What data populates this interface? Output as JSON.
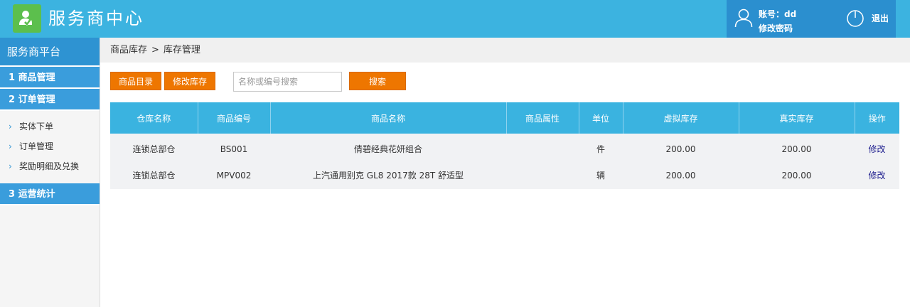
{
  "header": {
    "app_title": "服务商中心",
    "account_label": "账号：dd",
    "change_password": "修改密码",
    "logout": "退出",
    "colors": {
      "bar": "#3cb3e0",
      "user_panel": "#2b8fcf",
      "logo_bg": "#5cbf4d"
    }
  },
  "sidebar": {
    "title": "服务商平台",
    "groups": [
      {
        "label": "1 商品管理"
      },
      {
        "label": "2 订单管理",
        "items": [
          "实体下单",
          "订单管理",
          "奖励明细及兑换"
        ]
      },
      {
        "label": "3 运营统计"
      }
    ]
  },
  "breadcrumb": {
    "parent": "商品库存",
    "separator": ">",
    "current": "库存管理"
  },
  "toolbar": {
    "catalog_button": "商品目录",
    "edit_stock_button": "修改库存",
    "search_placeholder": "名称或编号搜索",
    "search_value": "",
    "search_button": "搜索",
    "accent_color": "#ee7600"
  },
  "table": {
    "columns": [
      "仓库名称",
      "商品编号",
      "商品名称",
      "商品属性",
      "单位",
      "虚拟库存",
      "真实库存",
      "操作"
    ],
    "rows": [
      {
        "warehouse": "连锁总部仓",
        "code": "BS001",
        "name": "倩碧经典花妍组合",
        "attr": "",
        "unit": "件",
        "virtual_stock": "200.00",
        "real_stock": "200.00",
        "action": "修改"
      },
      {
        "warehouse": "连锁总部仓",
        "code": "MPV002",
        "name": "上汽通用别克 GL8 2017款 28T 舒适型",
        "attr": "",
        "unit": "辆",
        "virtual_stock": "200.00",
        "real_stock": "200.00",
        "action": "修改"
      }
    ]
  }
}
